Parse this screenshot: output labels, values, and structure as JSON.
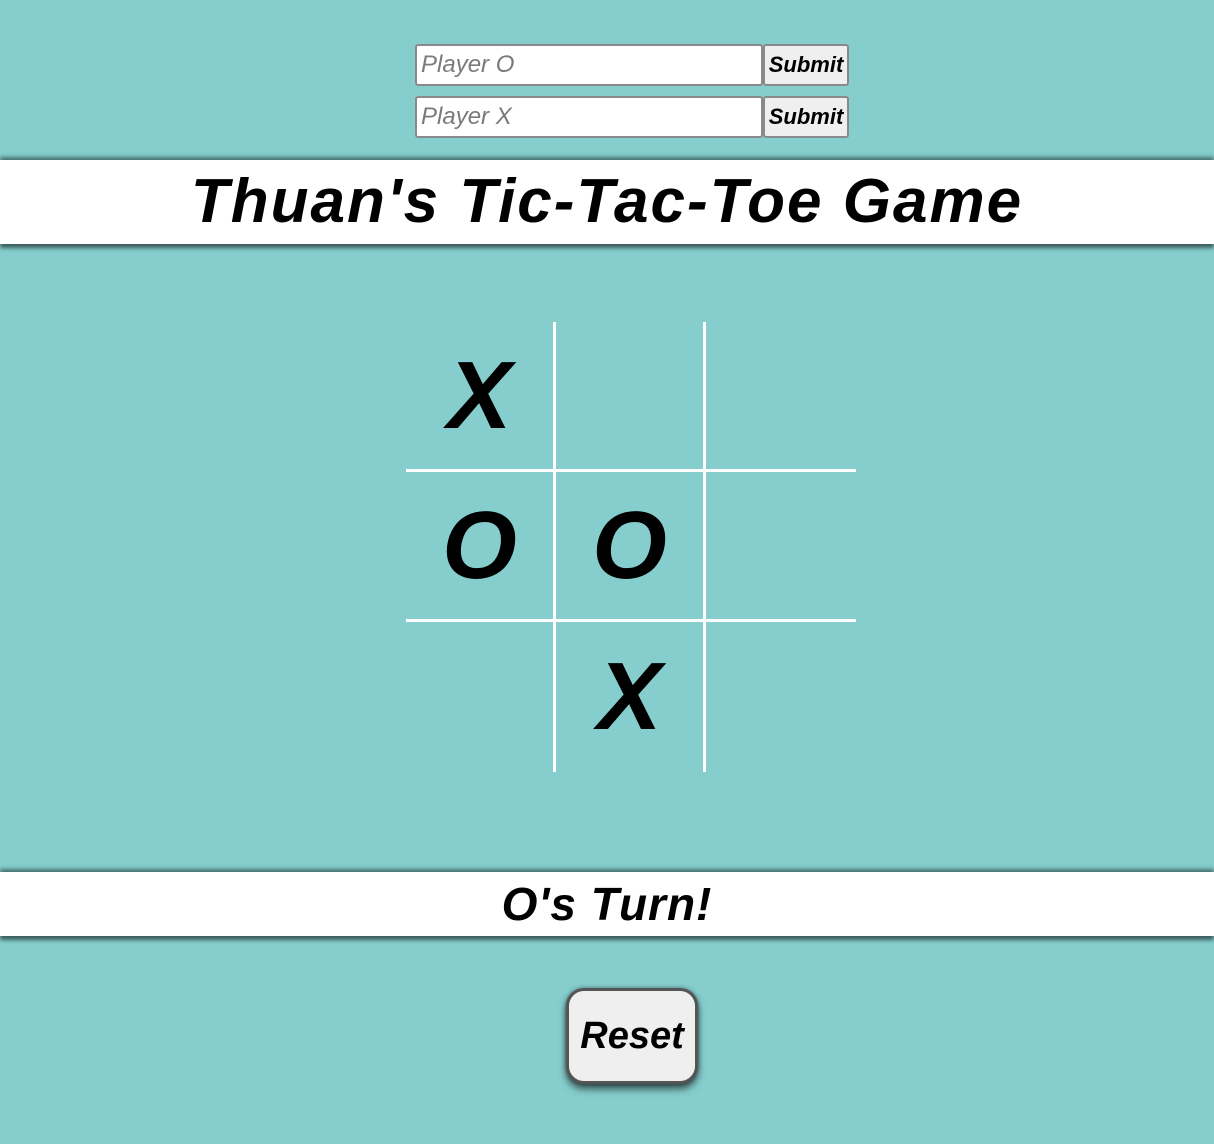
{
  "players": {
    "o": {
      "placeholder": "Player O",
      "value": "",
      "submit_label": "Submit"
    },
    "x": {
      "placeholder": "Player X",
      "value": "",
      "submit_label": "Submit"
    }
  },
  "title": "Thuan's Tic-Tac-Toe Game",
  "board": {
    "cells": [
      "X",
      "",
      "",
      "O",
      "O",
      "",
      "",
      "X",
      ""
    ]
  },
  "status": "O's Turn!",
  "reset_label": "Reset",
  "colors": {
    "background": "#86cece",
    "bar": "#ffffff",
    "grid_lines": "#ffffff",
    "marks": "#000000"
  }
}
